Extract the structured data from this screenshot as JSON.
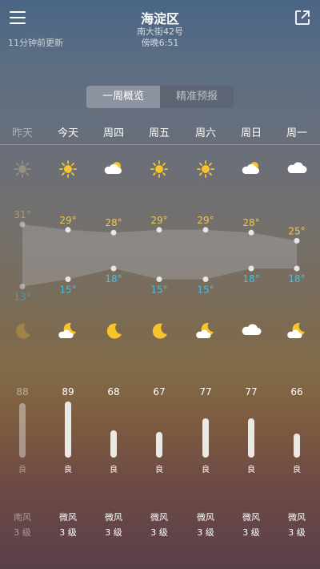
{
  "header": {
    "title": "海淀区",
    "street": "南大街42号",
    "time": "傍晚6:51",
    "updated": "11分钟前更新"
  },
  "tabs": {
    "overview": "一周概览",
    "precise": "精准预报"
  },
  "days": [
    {
      "label": "昨天",
      "day_icon": "sun-icon",
      "high": "31°",
      "low": "13°",
      "night_icon": "moon-icon",
      "aqi": "88",
      "aqi_level": "良",
      "wind_dir": "南风",
      "wind_level": "3 级"
    },
    {
      "label": "今天",
      "day_icon": "sun-icon",
      "high": "29°",
      "low": "15°",
      "night_icon": "moon-cloud-icon",
      "aqi": "89",
      "aqi_level": "良",
      "wind_dir": "微风",
      "wind_level": "3 级"
    },
    {
      "label": "周四",
      "day_icon": "cloud-sun-icon",
      "high": "28°",
      "low": "18°",
      "night_icon": "moon-icon",
      "aqi": "68",
      "aqi_level": "良",
      "wind_dir": "微风",
      "wind_level": "3 级"
    },
    {
      "label": "周五",
      "day_icon": "sun-icon",
      "high": "29°",
      "low": "15°",
      "night_icon": "moon-icon",
      "aqi": "67",
      "aqi_level": "良",
      "wind_dir": "微风",
      "wind_level": "3 级"
    },
    {
      "label": "周六",
      "day_icon": "sun-icon",
      "high": "29°",
      "low": "15°",
      "night_icon": "moon-cloud-icon",
      "aqi": "77",
      "aqi_level": "良",
      "wind_dir": "微风",
      "wind_level": "3 级"
    },
    {
      "label": "周日",
      "day_icon": "cloud-sun-icon",
      "high": "28°",
      "low": "18°",
      "night_icon": "cloud-icon",
      "aqi": "77",
      "aqi_level": "良",
      "wind_dir": "微风",
      "wind_level": "3 级"
    },
    {
      "label": "周一",
      "day_icon": "cloud-icon",
      "high": "25°",
      "low": "18°",
      "night_icon": "moon-cloud-icon",
      "aqi": "66",
      "aqi_level": "良",
      "wind_dir": "微风",
      "wind_level": "3 级"
    }
  ],
  "colors": {
    "high": "#f5c542",
    "low": "#3fc3e8",
    "sun": "#f7c52b"
  }
}
